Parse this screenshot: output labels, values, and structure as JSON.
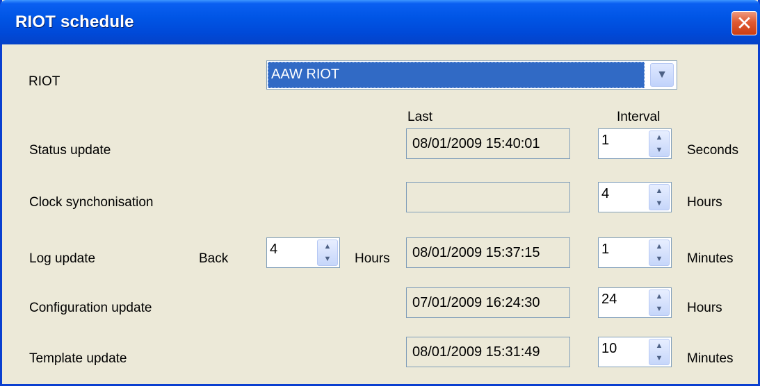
{
  "window": {
    "title": "RIOT schedule",
    "close_label": "✕"
  },
  "riot": {
    "label": "RIOT",
    "selected": "AAW RIOT"
  },
  "headers": {
    "last": "Last",
    "interval": "Interval"
  },
  "rows": {
    "status": {
      "label": "Status update",
      "last": "08/01/2009 15:40:01",
      "interval": "1",
      "unit": "Seconds"
    },
    "clock": {
      "label": "Clock synchonisation",
      "last": "",
      "interval": "4",
      "unit": "Hours"
    },
    "log": {
      "label": "Log update",
      "back_label": "Back",
      "back_value": "4",
      "back_unit": "Hours",
      "last": "08/01/2009 15:37:15",
      "interval": "1",
      "unit": "Minutes"
    },
    "config": {
      "label": "Configuration update",
      "last": "07/01/2009 16:24:30",
      "interval": "24",
      "unit": "Hours"
    },
    "template": {
      "label": "Template update",
      "last": "08/01/2009 15:31:49",
      "interval": "10",
      "unit": "Minutes"
    }
  },
  "icons": {
    "combo_arrow": "chevron-down-icon",
    "spin_up": "triangle-up-icon",
    "spin_down": "triangle-down-icon"
  }
}
